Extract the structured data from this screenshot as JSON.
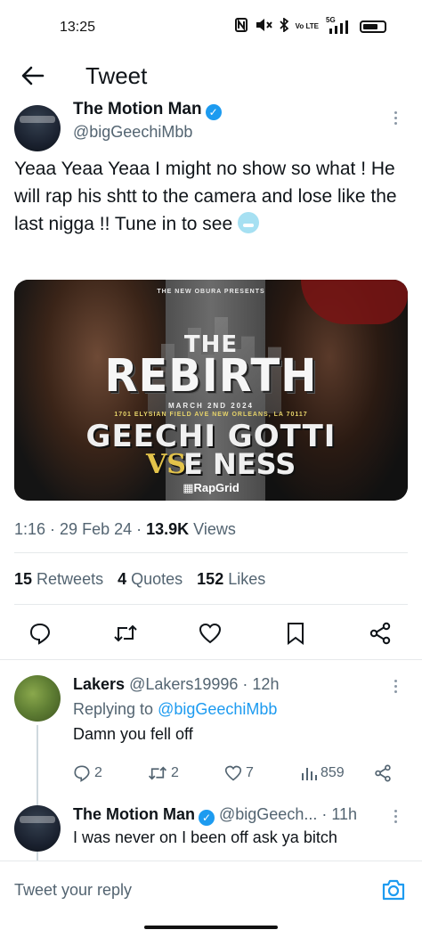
{
  "status_bar": {
    "time": "13:25",
    "icons": [
      "nfc-icon",
      "mute-icon",
      "bluetooth-icon",
      "volte-icon",
      "5g-signal-icon",
      "battery-icon"
    ],
    "network_label": "5G",
    "volte_label": "Vo LTE"
  },
  "header": {
    "title": "Tweet",
    "back_icon": "arrow-left-icon"
  },
  "tweet": {
    "author_name": "The Motion Man",
    "author_handle": "@bigGeechiMbb",
    "text": "Yeaa Yeaa Yeaa I might no show so what ! He will rap his shtt to the camera and lose like the last nigga !! Tune in to see",
    "media": {
      "presents": "THE NEW OBURA PRESENTS",
      "title_small": "THE",
      "title_big": "REBIRTH",
      "date": "MARCH 2ND 2024",
      "address": "1701 ELYSIAN FIELD AVE NEW ORLEANS, LA 70117",
      "line1": "GEECHI GOTTI",
      "vs": "VS",
      "line2": "E NESS",
      "brand": "RapGrid"
    },
    "time": "1:16",
    "date": "29 Feb 24",
    "views_count": "13.9K",
    "views_label": "Views",
    "retweets_count": "15",
    "retweets_label": "Retweets",
    "quotes_count": "4",
    "quotes_label": "Quotes",
    "likes_count": "152",
    "likes_label": "Likes"
  },
  "replies": [
    {
      "name": "Lakers",
      "handle": "@Lakers19996",
      "time": "12h",
      "replying_label": "Replying to",
      "replying_to": "@bigGeechiMbb",
      "text": "Damn you fell off",
      "replies_count": "2",
      "retweets_count": "2",
      "likes_count": "7",
      "views_count": "859"
    },
    {
      "name": "The Motion Man",
      "handle": "@bigGeech...",
      "time": "11h",
      "text": "I was never on I been off ask ya bitch"
    }
  ],
  "compose": {
    "placeholder": "Tweet your reply"
  },
  "colors": {
    "accent": "#1d9bf0",
    "text": "#0f1419",
    "secondary": "#536471"
  }
}
